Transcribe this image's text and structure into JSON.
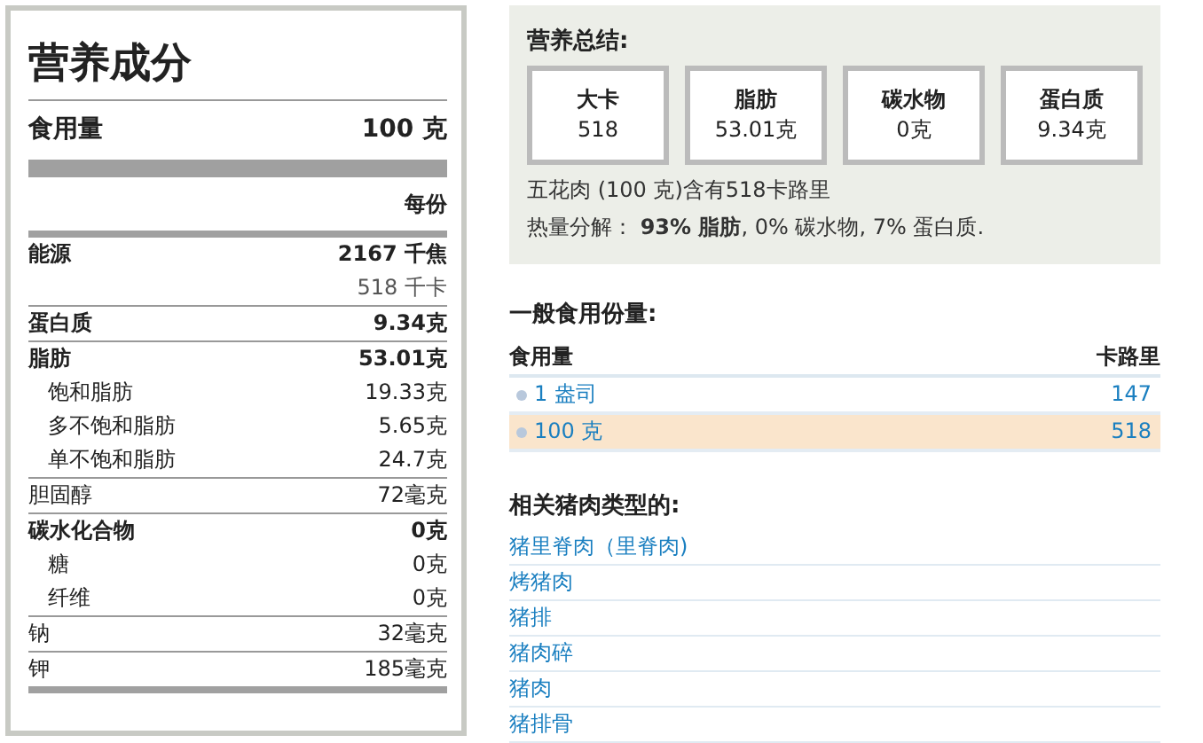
{
  "label": {
    "title": "营养成分",
    "serving": {
      "label": "食用量",
      "value": "100 克"
    },
    "per_header": "每份",
    "rows": [
      {
        "label": "能源",
        "value": "2167 千焦",
        "bold": true,
        "secondary": "518 千卡"
      },
      {
        "label": "蛋白质",
        "value": "9.34克",
        "bold": true
      },
      {
        "label": "脂肪",
        "value": "53.01克",
        "bold": true,
        "children": [
          {
            "label": "饱和脂肪",
            "value": "19.33克"
          },
          {
            "label": "多不饱和脂肪",
            "value": "5.65克"
          },
          {
            "label": "单不饱和脂肪",
            "value": "24.7克"
          }
        ]
      },
      {
        "label": "胆固醇",
        "value": "72毫克",
        "bold": false
      },
      {
        "label": "碳水化合物",
        "value": "0克",
        "bold": true,
        "children": [
          {
            "label": "糖",
            "value": "0克"
          },
          {
            "label": "纤维",
            "value": "0克"
          }
        ]
      },
      {
        "label": "钠",
        "value": "32毫克",
        "bold": false
      },
      {
        "label": "钾",
        "value": "185毫克",
        "bold": false
      }
    ]
  },
  "summary": {
    "title": "营养总结:",
    "boxes": [
      {
        "label": "大卡",
        "value": "518"
      },
      {
        "label": "脂肪",
        "value": "53.01克"
      },
      {
        "label": "碳水物",
        "value": "0克"
      },
      {
        "label": "蛋白质",
        "value": "9.34克"
      }
    ],
    "lines": [
      "五花肉 (100 克)含有518卡路里",
      "热量分解：  **93% 脂肪**, 0% 碳水物, 7% 蛋白质."
    ]
  },
  "servings": {
    "title": "一般食用份量:",
    "columns": [
      "食用量",
      "卡路里"
    ],
    "rows": [
      {
        "serving": "1 盎司",
        "calories": "147",
        "selected": false
      },
      {
        "serving": "100 克",
        "calories": "518",
        "selected": true
      }
    ]
  },
  "related": {
    "title": "相关猪肉类型的:",
    "links": [
      "猪里脊肉（里脊肉)",
      "烤猪肉",
      "猪排",
      "猪肉碎",
      "猪肉",
      "猪排骨"
    ]
  }
}
